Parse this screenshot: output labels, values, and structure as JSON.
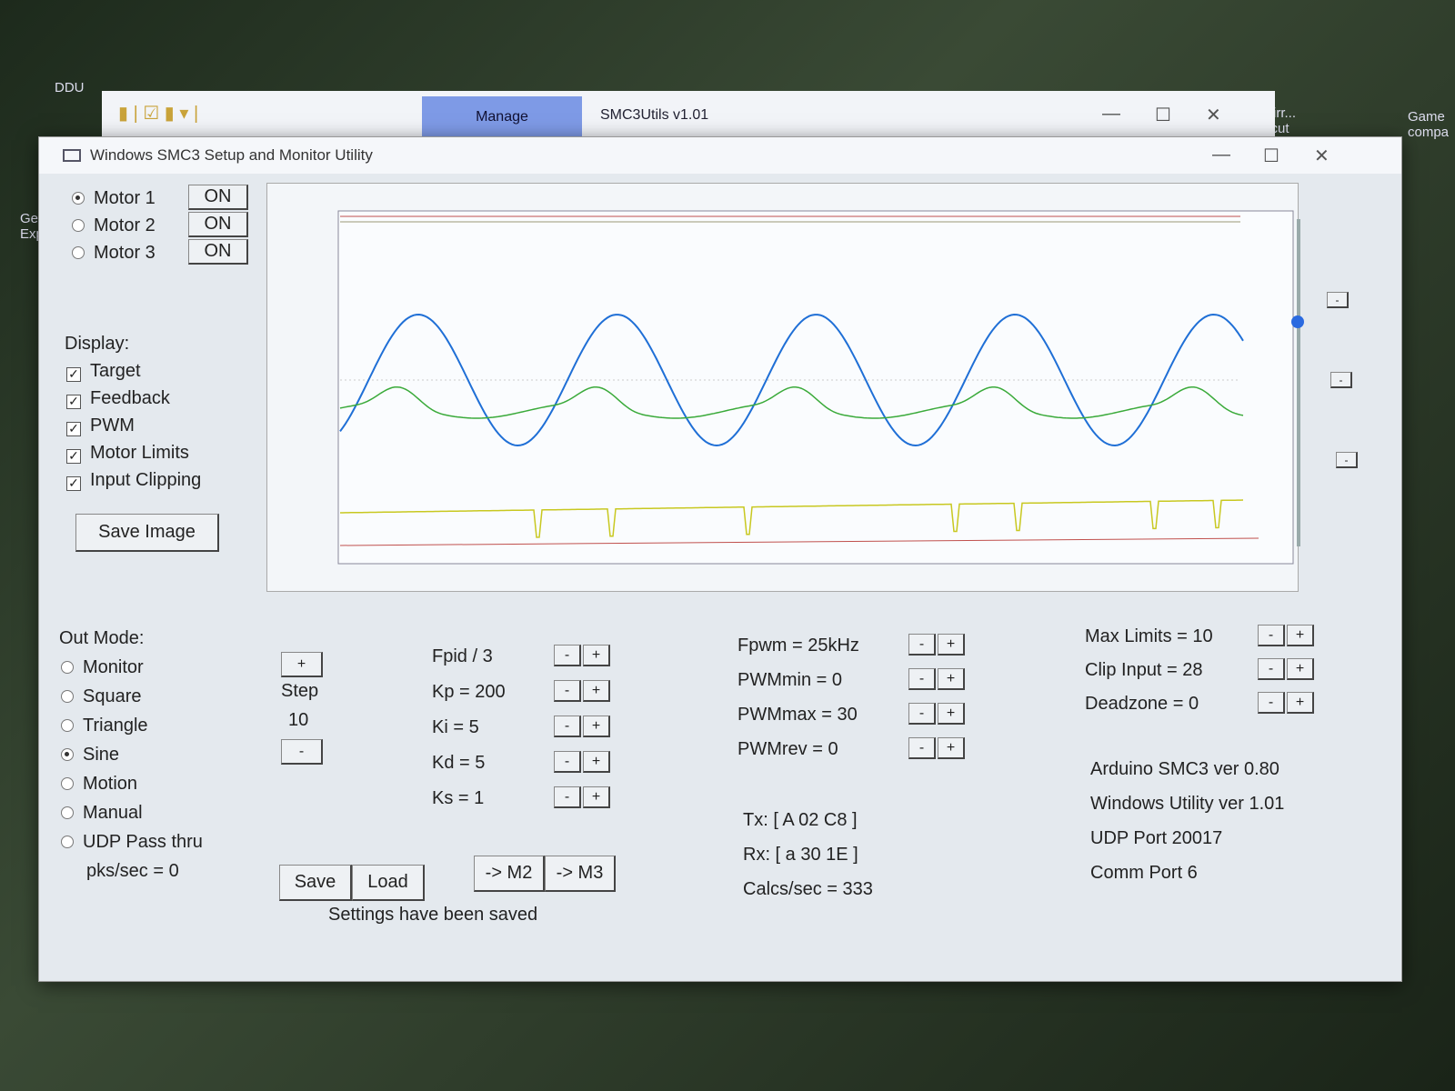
{
  "desktop": {
    "icons": [
      "DDU",
      "Ge Exp",
      "Game compa",
      "sMirr... ortcut"
    ]
  },
  "explorer": {
    "manage_tab": "Manage",
    "title": "SMC3Utils v1.01"
  },
  "window": {
    "title": "Windows SMC3 Setup and Monitor Utility"
  },
  "motors": [
    {
      "label": "Motor 1",
      "state": "ON",
      "selected": true
    },
    {
      "label": "Motor 2",
      "state": "ON",
      "selected": false
    },
    {
      "label": "Motor 3",
      "state": "ON",
      "selected": false
    }
  ],
  "display": {
    "heading": "Display:",
    "items": [
      "Target",
      "Feedback",
      "PWM",
      "Motor Limits",
      "Input Clipping"
    ],
    "save_image": "Save Image"
  },
  "out_mode": {
    "heading": "Out Mode:",
    "items": [
      "Monitor",
      "Square",
      "Triangle",
      "Sine",
      "Motion",
      "Manual",
      "UDP Pass thru"
    ],
    "selected": "Sine",
    "pks": "pks/sec = 0"
  },
  "step": {
    "plus": "+",
    "label": "Step",
    "value": "10",
    "minus": "-"
  },
  "pid": [
    "Fpid / 3",
    "Kp = 200",
    "Ki = 5",
    "Kd = 5",
    "Ks = 1"
  ],
  "pwm": [
    "Fpwm = 25kHz",
    "PWMmin = 0",
    "PWMmax = 30",
    "PWMrev = 0"
  ],
  "limits": [
    "Max Limits = 10",
    "Clip Input = 28",
    "Deadzone = 0"
  ],
  "comm": {
    "tx": "Tx: [ A 02 C8 ]",
    "rx": "Rx: [ a 30 1E ]",
    "calcs": "Calcs/sec = 333"
  },
  "info": [
    "Arduino SMC3 ver 0.80",
    "Windows Utility ver 1.01",
    "UDP Port 20017",
    "Comm Port 6"
  ],
  "buttons": {
    "save": "Save",
    "load": "Load",
    "m2": "-> M2",
    "m3": "-> M3",
    "minus": "-",
    "plus": "+"
  },
  "status": "Settings have been saved",
  "colors": {
    "target": "#1f6fd6",
    "feedback": "#3aaa3a",
    "pwm": "#c8c820",
    "limits": "#c0504d"
  }
}
